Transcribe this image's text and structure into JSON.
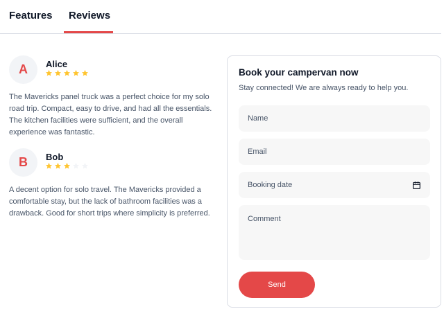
{
  "tabs": {
    "features_label": "Features",
    "reviews_label": "Reviews",
    "active": "Reviews"
  },
  "reviews": [
    {
      "initial": "A",
      "name": "Alice",
      "rating": 5,
      "max_rating": 5,
      "text": "The Mavericks panel truck was a perfect choice for my solo road trip. Compact, easy to drive, and had all the essentials. The kitchen facilities were sufficient, and the overall experience was fantastic."
    },
    {
      "initial": "B",
      "name": "Bob",
      "rating": 3,
      "max_rating": 5,
      "text": "A decent option for solo travel. The Mavericks provided a comfortable stay, but the lack of bathroom facilities was a drawback. Good for short trips where simplicity is preferred."
    }
  ],
  "booking": {
    "title": "Book your campervan now",
    "subtitle": "Stay connected! We are always ready to help you.",
    "name_placeholder": "Name",
    "email_placeholder": "Email",
    "date_placeholder": "Booking date",
    "comment_placeholder": "Comment",
    "send_label": "Send"
  },
  "colors": {
    "accent": "#e44848",
    "star_filled": "#ffc531",
    "star_empty": "#f2f4f7"
  }
}
